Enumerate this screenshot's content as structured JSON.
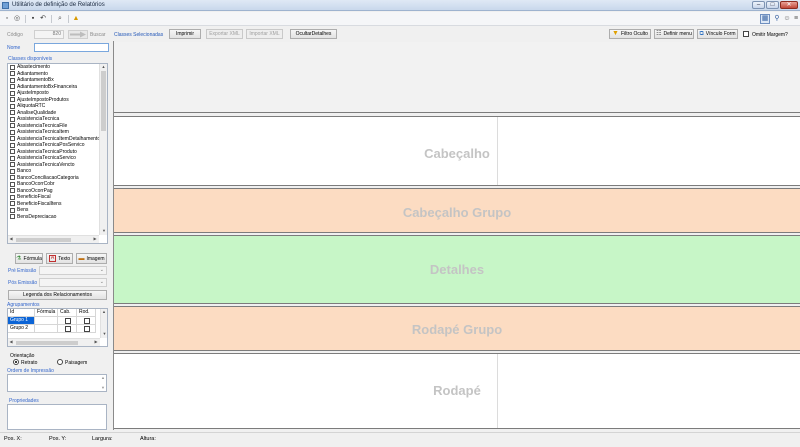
{
  "window": {
    "title": "Utilitário de definição de Relatórios",
    "controls": [
      "–",
      "□",
      "✕"
    ]
  },
  "toolbar": {
    "icons": [
      "new-icon",
      "open-icon",
      "save-icon",
      "undo-icon",
      "zoom-icon",
      "warning-icon"
    ],
    "right_icons": [
      "layout-icon",
      "search-icon",
      "user-icon",
      "grid-icon"
    ]
  },
  "top": {
    "codigo_label": "Código",
    "codigo_value": "820",
    "buscar_label": "Buscar",
    "classes_label": "Classes Selecionadas",
    "imprimir": "Imprimir",
    "exportar_xml": "Exportar XML",
    "importar_xml": "Importar XML",
    "ocultar_detalhes": "OcultarDetalhes",
    "filtro_oculto": "Filtro Oculto",
    "definir_menu": "Definir menu",
    "vinculo_form": "Vínculo Form",
    "omitir_margem": "Omitir Margem?"
  },
  "left": {
    "nome_label": "Nome",
    "classes_disponiveis_label": "Classes disponíveis",
    "classes": [
      "Abastecimento",
      "Adiantamento",
      "AdiantamentoBx",
      "AdiantamentoBxFinanceira",
      "AjusteImposto",
      "AjusteImpostoProdutos",
      "AliquotaRTC",
      "AnaliseQualidade",
      "AssistenciaTecnica",
      "AssistenciaTecnicaFile",
      "AssistenciaTecnicaItem",
      "AssistenciaTecnicaItemDetalhamento",
      "AssistenciaTecnicaPosServico",
      "AssistenciaTecnicaProduto",
      "AssistenciaTecnicaServico",
      "AssistenciaTecnicaVencto",
      "Banco",
      "BancoConciliacaoCategoria",
      "BancoOcorrCobr",
      "BancoOcorrPag",
      "BeneficioFiscal",
      "BeneficioFiscalItens",
      "Bens",
      "BensDepreciacao"
    ],
    "formula_button": "Fórmula",
    "texto_button": "Texto",
    "imagem_button": "Imagem",
    "pre_emissao_label": "Pré Emissão",
    "pos_emissao_label": "Pós Emissão",
    "legenda_button": "Legenda dos Relacionamentos",
    "agrupamentos_label": "Agrupamentos",
    "grid_headers": [
      "Id",
      "Fórmula",
      "Cab.",
      "Rod."
    ],
    "grid_rows": [
      {
        "id": "Grupo 1",
        "formula": ""
      },
      {
        "id": "Grupo 2",
        "formula": ""
      }
    ],
    "orientacao_label": "Orientação",
    "retrato_label": "Retrato",
    "paisagem_label": "Paisagem",
    "ordem_label": "Ordem de Impressão",
    "propriedades_label": "Propriedades"
  },
  "bands": {
    "cabecalho": "Cabeçalho",
    "cabecalho_grupo": "Cabeçalho Grupo",
    "detalhes": "Detalhes",
    "rodape_grupo": "Rodapé Grupo",
    "rodape": "Rodapé"
  },
  "colors": {
    "orange_band": "#fcdcc2",
    "green_band": "#c7f6c7",
    "white_band": "#ffffff",
    "gray_band": "#f2f2f2",
    "label_blue": "#3366cc"
  },
  "status": {
    "pos_x": "Pos. X:",
    "pos_y": "Pos. Y:",
    "largura": "Largura:",
    "altura": "Altura:"
  }
}
